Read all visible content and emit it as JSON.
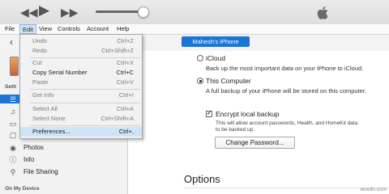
{
  "menubar": {
    "items": [
      "File",
      "Edit",
      "View",
      "Controls",
      "Account",
      "Help"
    ]
  },
  "toolbar": {
    "device_button": "Mahesh's iPhone"
  },
  "edit_menu": {
    "items": [
      {
        "label": "Undo",
        "shortcut": "Ctrl+Z",
        "enabled": false
      },
      {
        "label": "Redo",
        "shortcut": "Ctrl+Shift+Z",
        "enabled": false
      },
      {
        "label": "Cut",
        "shortcut": "Ctrl+X",
        "enabled": false
      },
      {
        "label": "Copy Serial Number",
        "shortcut": "Ctrl+C",
        "enabled": true
      },
      {
        "label": "Paste",
        "shortcut": "Ctrl+V",
        "enabled": false
      },
      {
        "label": "Get Info",
        "shortcut": "Ctrl+I",
        "enabled": false
      },
      {
        "label": "Select All",
        "shortcut": "Ctrl+A",
        "enabled": false
      },
      {
        "label": "Select None",
        "shortcut": "Ctrl+Shift+A",
        "enabled": false
      },
      {
        "label": "Preferences...",
        "shortcut": "Ctrl+,",
        "enabled": true,
        "highlighted": true
      }
    ]
  },
  "sidebar": {
    "section_settings": "Setti",
    "items": [
      {
        "label": "Photos",
        "icon": "photos-icon"
      },
      {
        "label": "Info",
        "icon": "info-icon"
      },
      {
        "label": "File Sharing",
        "icon": "file-sharing-icon"
      }
    ],
    "section_device": "On My Device"
  },
  "backups": {
    "icloud": {
      "title": "iCloud",
      "desc": "Back up the most important data on your iPhone to iCloud.",
      "selected": false
    },
    "this_computer": {
      "title": "This Computer",
      "desc": "A full backup of your iPhone will be stored on this computer.",
      "selected": true
    },
    "encrypt": {
      "title": "Encrypt local backup",
      "desc": "This will allow account passwords, Health, and HomeKit data to be backed up.",
      "checked": true
    },
    "change_password": "Change Password..."
  },
  "options_heading": "Options",
  "watermark": "wsxdn.com",
  "colors": {
    "accent": "#1b74d6",
    "menu_highlight": "#cfe4f7"
  }
}
